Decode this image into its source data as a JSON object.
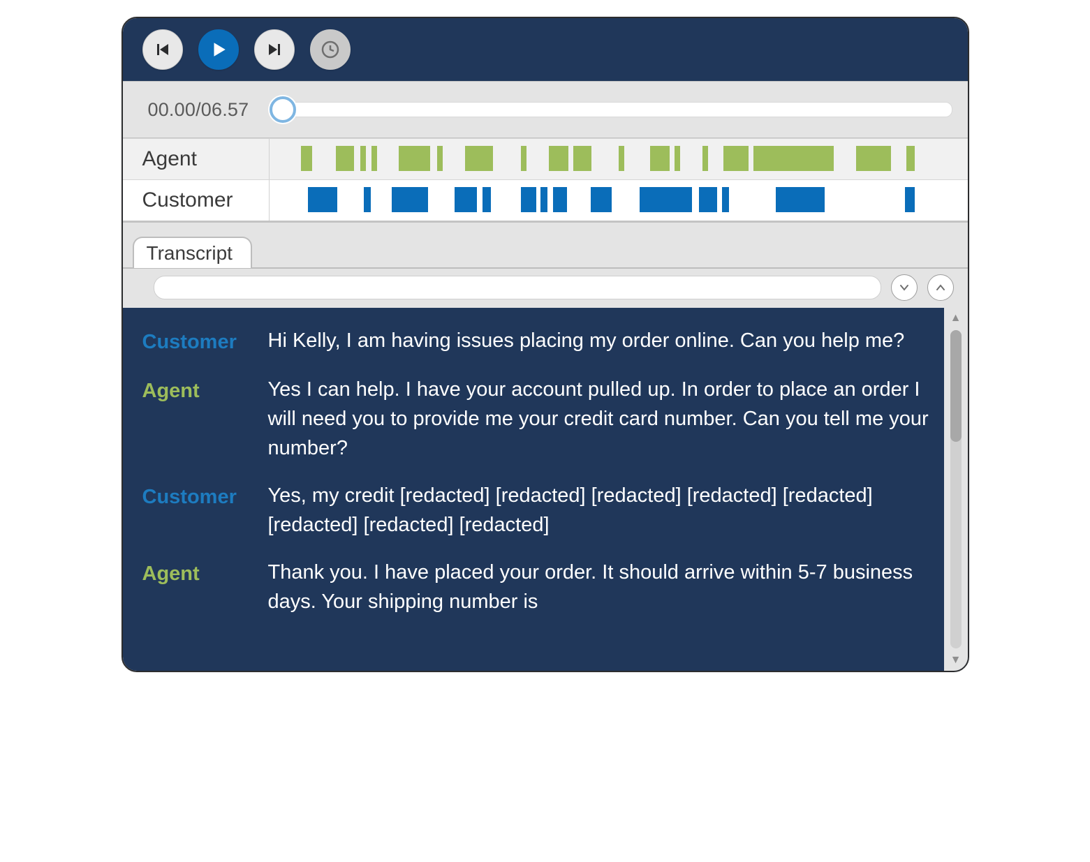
{
  "playback": {
    "current": "00.00",
    "total": "06.57",
    "timecode_combined": "00.00/06.57"
  },
  "waveform": {
    "labels": {
      "agent": "Agent",
      "customer": "Customer"
    },
    "agent_segments": [
      {
        "l": 4.5,
        "w": 1.6
      },
      {
        "l": 9.5,
        "w": 2.6
      },
      {
        "l": 13.0,
        "w": 0.8
      },
      {
        "l": 14.6,
        "w": 0.8
      },
      {
        "l": 18.5,
        "w": 4.5
      },
      {
        "l": 24.0,
        "w": 0.8
      },
      {
        "l": 28.0,
        "w": 4.0
      },
      {
        "l": 36.0,
        "w": 0.8
      },
      {
        "l": 40.0,
        "w": 2.8
      },
      {
        "l": 43.5,
        "w": 2.6
      },
      {
        "l": 50.0,
        "w": 0.8
      },
      {
        "l": 54.5,
        "w": 2.8
      },
      {
        "l": 58.0,
        "w": 0.8
      },
      {
        "l": 62.0,
        "w": 0.8
      },
      {
        "l": 65.0,
        "w": 3.6
      },
      {
        "l": 69.3,
        "w": 11.5
      },
      {
        "l": 84.0,
        "w": 5.0
      },
      {
        "l": 91.2,
        "w": 1.2
      }
    ],
    "customer_segments": [
      {
        "l": 5.5,
        "w": 4.2
      },
      {
        "l": 13.5,
        "w": 1.0
      },
      {
        "l": 17.5,
        "w": 5.2
      },
      {
        "l": 26.5,
        "w": 3.2
      },
      {
        "l": 30.5,
        "w": 1.2
      },
      {
        "l": 36.0,
        "w": 2.2
      },
      {
        "l": 38.8,
        "w": 1.0
      },
      {
        "l": 40.6,
        "w": 2.0
      },
      {
        "l": 46.0,
        "w": 3.0
      },
      {
        "l": 53.0,
        "w": 7.5
      },
      {
        "l": 61.5,
        "w": 2.6
      },
      {
        "l": 64.8,
        "w": 1.0
      },
      {
        "l": 72.5,
        "w": 7.0
      },
      {
        "l": 91.0,
        "w": 1.4
      }
    ]
  },
  "tabs": {
    "transcript_label": "Transcript"
  },
  "search": {
    "placeholder": ""
  },
  "transcript": [
    {
      "speaker": "Customer",
      "kind": "cust",
      "text": "Hi Kelly, I am having issues placing my order online. Can you help me?"
    },
    {
      "speaker": "Agent",
      "kind": "agent",
      "text": "Yes I can help. I have your account pulled up. In order to place an order I will need you to provide me your credit card number. Can you tell me your number?"
    },
    {
      "speaker": "Customer",
      "kind": "cust",
      "text": "Yes, my credit [redacted] [redacted] [redacted] [redacted] [redacted] [redacted] [redacted] [redacted]"
    },
    {
      "speaker": "Agent",
      "kind": "agent",
      "text": "Thank you. I have placed your order. It should arrive within 5-7 business days. Your shipping number is"
    }
  ],
  "colors": {
    "brand_dark": "#20375a",
    "accent_blue": "#0a6db9",
    "agent_green": "#9dbd5b",
    "panel_grey": "#e4e4e4"
  }
}
